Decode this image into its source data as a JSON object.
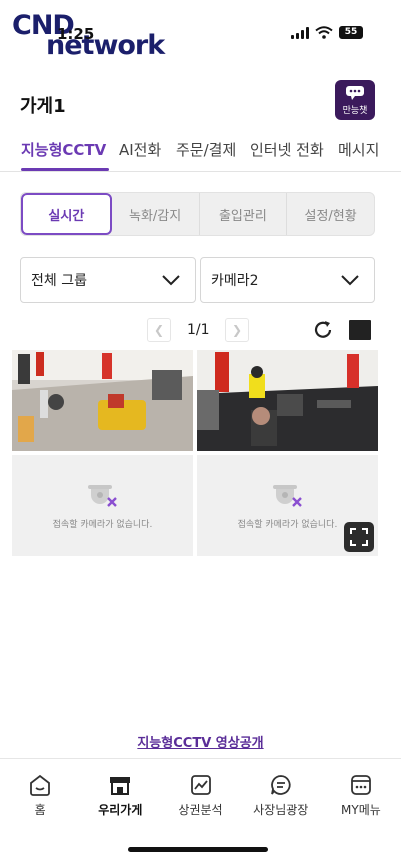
{
  "status_bar": {
    "time": "1:25",
    "battery": "55",
    "logo_line1": "CND",
    "logo_line2": "network"
  },
  "header": {
    "title": "가게1",
    "chat_button_label": "만능챗"
  },
  "tabs": [
    {
      "label": "지능형CCTV",
      "active": true
    },
    {
      "label": "AI전화"
    },
    {
      "label": "주문/결제"
    },
    {
      "label": "인터넷 전화"
    },
    {
      "label": "메시지"
    }
  ],
  "subtabs": [
    {
      "label": "실시간",
      "active": true
    },
    {
      "label": "녹화/감지"
    },
    {
      "label": "출입관리"
    },
    {
      "label": "설정/현황"
    }
  ],
  "filters": {
    "group_select": "전체 그룹",
    "camera_select": "카메라2"
  },
  "pager": {
    "page_text": "1/1"
  },
  "cameras": {
    "empty_message": "접속할 카메라가 없습니다."
  },
  "video_link": "지능형CCTV 영상공개",
  "bottom_nav": [
    {
      "label": "홈",
      "icon": "home-icon"
    },
    {
      "label": "우리가게",
      "icon": "store-icon",
      "active": true
    },
    {
      "label": "상권분석",
      "icon": "chart-icon"
    },
    {
      "label": "사장님광장",
      "icon": "chat-icon"
    },
    {
      "label": "MY메뉴",
      "icon": "menu-icon"
    }
  ],
  "colors": {
    "accent": "#6b3ab3",
    "chat_button": "#3b1a5c",
    "link": "#5a2d98"
  }
}
